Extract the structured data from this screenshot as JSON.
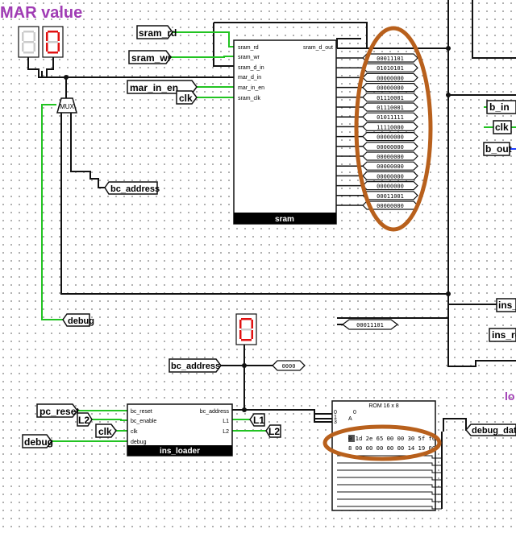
{
  "title_label": "MAR value",
  "right_edge_label": "lo",
  "colors": {
    "wire_green": "#22c322",
    "wire_black": "#111111",
    "wire_blue": "#1e3cff",
    "annotation_brown": "#b8601c",
    "title_purple": "#a03cb4",
    "seg_red": "#e01010"
  },
  "inputs": {
    "sram_rd": "sram_rd",
    "sram_wr": "sram_wr",
    "mar_in_en": "mar_in_en",
    "clk": "clk",
    "bc_address": "bc_address",
    "debug": "debug",
    "bc_address2": "bc_address",
    "pc_reset": "pc_reset",
    "l2_in": "L2",
    "clk2": "clk",
    "debug2": "debug",
    "b_in": "b_in",
    "clk_right": "clk",
    "b_out": "b_out",
    "ins_r1": "ins_",
    "ins_r2": "ins_re",
    "debug_data": "debug_data",
    "l1_out": "L1",
    "l2_out": "L2"
  },
  "mux_label": "MUX",
  "sram": {
    "title": "sram",
    "pins_left": [
      "sram_rd",
      "sram_wr",
      "sram_d_in",
      "mar_d_in",
      "mar_in_en",
      "sram_clk"
    ],
    "pin_right": "sram_d_out"
  },
  "memory_values": [
    "00011101",
    "01010101",
    "00000000",
    "00000000",
    "01110001",
    "01110001",
    "01011111",
    "11110000",
    "00000000",
    "00000000",
    "00000000",
    "00000000",
    "00000000",
    "00000000",
    "00011001",
    "00000000"
  ],
  "bus_value": "00011101",
  "probe_value": "0000",
  "ins_loader": {
    "title": "ins_loader",
    "pins_left": [
      "bc_reset",
      "bc_enable",
      "clk",
      "debug"
    ],
    "pins_right": [
      "bc_address",
      "L1",
      "L2"
    ]
  },
  "rom": {
    "title": "ROM 16 x 8",
    "addr_pins": [
      "0",
      "1",
      "2",
      "3"
    ],
    "cs_label": "0",
    "cs_label2": "A",
    "row1": "0 1d 2e 65 00 00 30 5f f0",
    "row2": "8 00 00 00 00 00 14 19 00"
  }
}
